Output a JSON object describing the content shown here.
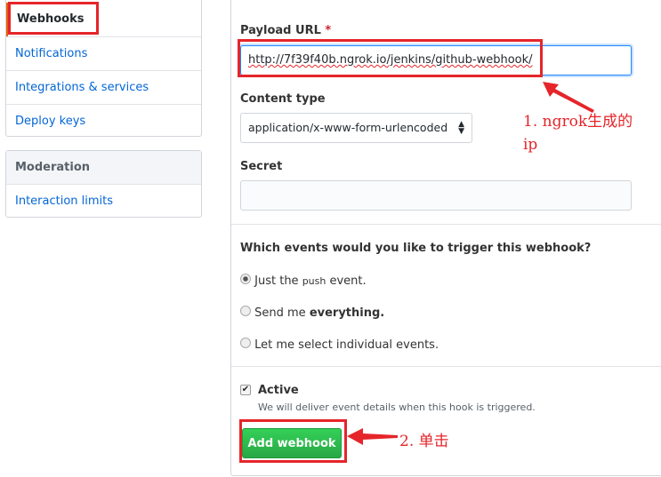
{
  "sidebar": {
    "items": [
      {
        "label": "Webhooks",
        "selected": true
      },
      {
        "label": "Notifications"
      },
      {
        "label": "Integrations & services"
      },
      {
        "label": "Deploy keys"
      }
    ],
    "moderation": {
      "header": "Moderation",
      "items": [
        {
          "label": "Interaction limits"
        }
      ]
    }
  },
  "form": {
    "payload_label": "Payload URL",
    "required_mark": "*",
    "payload_value": "http://7f39f40b.ngrok.io/jenkins/github-webhook/",
    "content_type_label": "Content type",
    "content_type_value": "application/x-www-form-urlencoded",
    "secret_label": "Secret",
    "secret_value": "",
    "events_question": "Which events would you like to trigger this webhook?",
    "events": [
      {
        "pre": "Just the ",
        "code": "push",
        "post": " event.",
        "checked": true
      },
      {
        "pre": "Send me ",
        "bold": "everything.",
        "checked": false
      },
      {
        "pre": "Let me select individual events.",
        "checked": false
      }
    ],
    "active_label": "Active",
    "active_checked": true,
    "active_note": "We will deliver event details when this hook is triggered.",
    "submit_label": "Add webhook"
  },
  "annotations": {
    "a1_line1": "1. ngrok生成的",
    "a1_line2": "ip",
    "a2": "2. 单击",
    "color": "#e5252a"
  },
  "colors": {
    "link": "#0366d6",
    "button": "#28a745"
  }
}
